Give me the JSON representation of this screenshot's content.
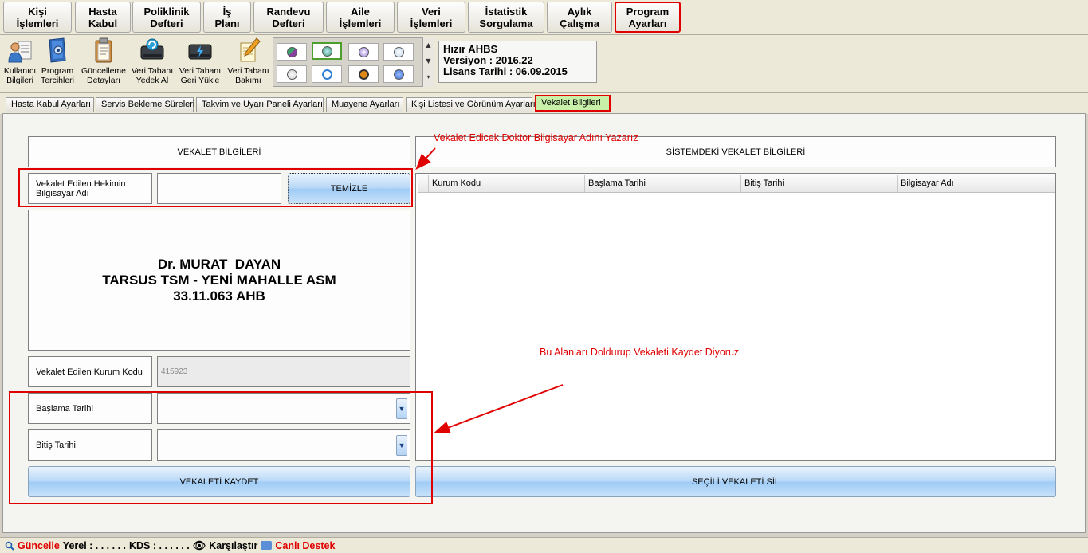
{
  "menu": {
    "items": [
      {
        "line1": "Kişi",
        "line2": "İşlemleri"
      },
      {
        "line1": "Hasta",
        "line2": "Kabul"
      },
      {
        "line1": "Poliklinik",
        "line2": "Defteri"
      },
      {
        "line1": "İş",
        "line2": "Planı"
      },
      {
        "line1": "Randevu",
        "line2": "Defteri"
      },
      {
        "line1": "Aile",
        "line2": "İşlemleri"
      },
      {
        "line1": "Veri",
        "line2": "İşlemleri"
      },
      {
        "line1": "İstatistik",
        "line2": "Sorgulama"
      },
      {
        "line1": "Aylık",
        "line2": "Çalışma"
      },
      {
        "line1": "Program",
        "line2": "Ayarları"
      }
    ]
  },
  "toolbar": {
    "items": [
      {
        "line1": "Kullanıcı",
        "line2": "Bilgileri",
        "icon": "user-icon"
      },
      {
        "line1": "Program",
        "line2": "Tercihleri",
        "icon": "settings-book-icon"
      },
      {
        "line1": "Güncelleme",
        "line2": "Detayları",
        "icon": "clipboard-icon"
      },
      {
        "line1": "Veri Tabanı",
        "line2": "Yedek Al",
        "icon": "database-backup-icon"
      },
      {
        "line1": "Veri Tabanı",
        "line2": "Geri Yükle",
        "icon": "database-restore-icon"
      },
      {
        "line1": "Veri Tabanı",
        "line2": "Bakımı",
        "icon": "database-repair-icon"
      }
    ],
    "theme_colors": [
      "#8a3fa0",
      "#3aa26a",
      "#8b6fd1",
      "#bcd4ea",
      "#d4d4d4",
      "#2f7fd6",
      "#e08a16",
      "#3b6fcf"
    ]
  },
  "app_info": {
    "name": "Hızır AHBS",
    "version": "Versiyon : 2016.22",
    "license": "Lisans Tarihi : 06.09.2015"
  },
  "tabs": [
    "Hasta Kabul Ayarları",
    "Servis Bekleme Süreleri",
    "Takvim ve Uyarı Paneli Ayarları",
    "Muayene Ayarları",
    "Kişi Listesi ve Görünüm Ayarları",
    "Vekalet Bilgileri"
  ],
  "left_panel": {
    "header": "VEKALET BİLGİLERİ",
    "computer_name_label": "Vekalet Edilen Hekimin Bilgisayar Adı",
    "computer_name_value": "",
    "clear_button": "TEMİZLE",
    "doctor": {
      "name": "Dr. MURAT  DAYAN",
      "institution": "TARSUS TSM - YENİ MAHALLE ASM",
      "code": "33.11.063 AHB"
    },
    "institution_code_label": "Vekalet Edilen Kurum Kodu",
    "institution_code_value": "415923",
    "start_date_label": "Başlama Tarihi",
    "end_date_label": "Bitiş Tarihi",
    "save_button": "VEKALETİ KAYDET"
  },
  "right_panel": {
    "header": "SİSTEMDEKİ VEKALET BİLGİLERİ",
    "columns": [
      "Kurum Kodu",
      "Başlama Tarihi",
      "Bitiş Tarihi",
      "Bilgisayar Adı"
    ],
    "rows": [],
    "delete_button": "SEÇİLİ VEKALETİ SİL"
  },
  "annotations": {
    "top": "Vekalet Edicek Doktor Bilgisayar Adını Yazarız",
    "middle": "Bu Alanları Doldurup Vekaleti Kaydet Diyoruz"
  },
  "statusbar": {
    "update": "Güncelle",
    "local": "Yerel :  . .  . .  . .",
    "kds": "KDS :  . .  . .  . .",
    "compare": "Karşılaştır",
    "support": "Canlı Destek"
  }
}
